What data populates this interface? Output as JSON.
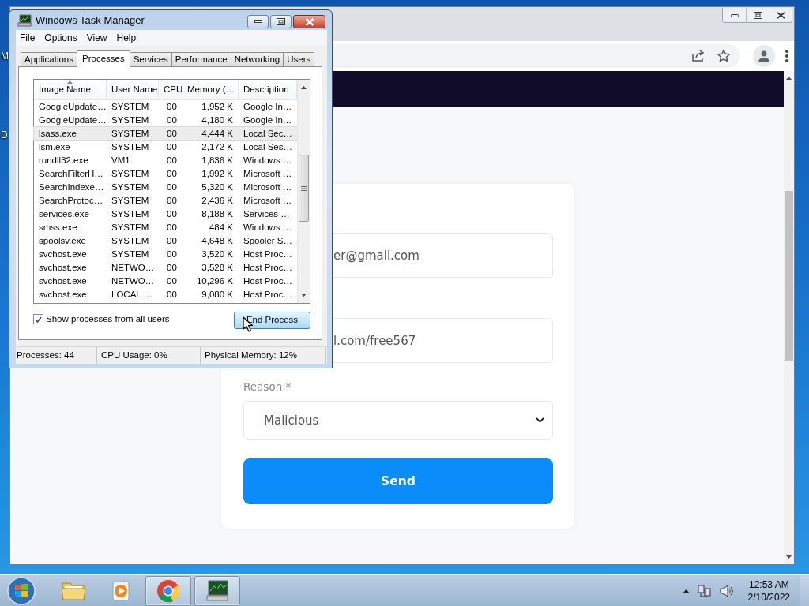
{
  "desktop": {
    "icon_labels": [
      "M",
      "D"
    ]
  },
  "browser": {
    "form": {
      "email_value": "er@gmail.com",
      "link_value": "l.com/free567",
      "reason_label": "Reason *",
      "reason_value": "Malicious",
      "submit": "Send"
    }
  },
  "task_manager": {
    "title": "Windows Task Manager",
    "menu": [
      "File",
      "Options",
      "View",
      "Help"
    ],
    "tabs": [
      {
        "label": "Applications",
        "selected": false
      },
      {
        "label": "Processes",
        "selected": true
      },
      {
        "label": "Services",
        "selected": false
      },
      {
        "label": "Performance",
        "selected": false
      },
      {
        "label": "Networking",
        "selected": false
      },
      {
        "label": "Users",
        "selected": false
      }
    ],
    "columns": [
      {
        "label": "Image Name",
        "sorted": true
      },
      {
        "label": "User Name",
        "sorted": false
      },
      {
        "label": "CPU",
        "sorted": false
      },
      {
        "label": "Memory (…",
        "sorted": false
      },
      {
        "label": "Description",
        "sorted": false
      }
    ],
    "rows": [
      {
        "cells": [
          "GoogleUpdate…",
          "SYSTEM",
          "00",
          "1,952 K",
          "Google In…"
        ],
        "selected": false
      },
      {
        "cells": [
          "GoogleUpdate…",
          "SYSTEM",
          "00",
          "4,180 K",
          "Google In…"
        ],
        "selected": false
      },
      {
        "cells": [
          "lsass.exe",
          "SYSTEM",
          "00",
          "4,444 K",
          "Local Sec…"
        ],
        "selected": true
      },
      {
        "cells": [
          "lsm.exe",
          "SYSTEM",
          "00",
          "2,172 K",
          "Local Ses…"
        ],
        "selected": false
      },
      {
        "cells": [
          "rundll32.exe",
          "VM1",
          "00",
          "1,836 K",
          "Windows …"
        ],
        "selected": false
      },
      {
        "cells": [
          "SearchFilterH…",
          "SYSTEM",
          "00",
          "1,992 K",
          "Microsoft …"
        ],
        "selected": false
      },
      {
        "cells": [
          "SearchIndexe…",
          "SYSTEM",
          "00",
          "5,320 K",
          "Microsoft …"
        ],
        "selected": false
      },
      {
        "cells": [
          "SearchProtoc…",
          "SYSTEM",
          "00",
          "2,436 K",
          "Microsoft …"
        ],
        "selected": false
      },
      {
        "cells": [
          "services.exe",
          "SYSTEM",
          "00",
          "8,188 K",
          "Services …"
        ],
        "selected": false
      },
      {
        "cells": [
          "smss.exe",
          "SYSTEM",
          "00",
          "484 K",
          "Windows …"
        ],
        "selected": false
      },
      {
        "cells": [
          "spoolsv.exe",
          "SYSTEM",
          "00",
          "4,648 K",
          "Spooler S…"
        ],
        "selected": false
      },
      {
        "cells": [
          "svchost.exe",
          "SYSTEM",
          "00",
          "3,520 K",
          "Host Proc…"
        ],
        "selected": false
      },
      {
        "cells": [
          "svchost.exe",
          "NETWO…",
          "00",
          "3,528 K",
          "Host Proc…"
        ],
        "selected": false
      },
      {
        "cells": [
          "svchost.exe",
          "NETWO…",
          "00",
          "10,296 K",
          "Host Proc…"
        ],
        "selected": false
      },
      {
        "cells": [
          "svchost.exe",
          "LOCAL …",
          "00",
          "9,080 K",
          "Host Proc…"
        ],
        "selected": false
      }
    ],
    "show_all_users": {
      "label": "Show processes from all users",
      "checked": true
    },
    "end_process": "End Process",
    "status_bar": [
      "Processes: 44",
      "CPU Usage: 0%",
      "Physical Memory: 12%"
    ]
  },
  "taskbar": {
    "apps": [
      {
        "kind": "folder",
        "active": false
      },
      {
        "kind": "media",
        "active": false
      },
      {
        "kind": "browser",
        "active": true
      },
      {
        "kind": "taskmgr",
        "active": true
      }
    ],
    "clock": {
      "time": "12:53 AM",
      "date": "2/10/2022"
    }
  }
}
